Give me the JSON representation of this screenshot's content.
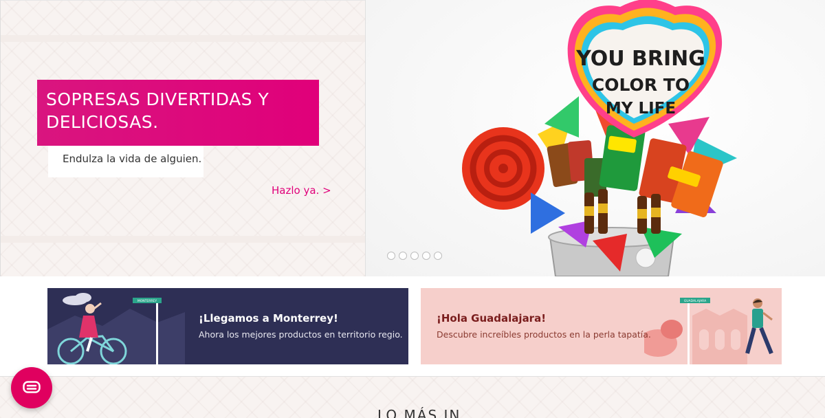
{
  "hero": {
    "title": "SOPRESAS DIVERTIDAS Y DELICIOSAS.",
    "subtitle": "Endulza la vida de alguien.",
    "cta": "Hazlo ya. >",
    "balloon_text": [
      "YOU BRING",
      "COLOR TO",
      "MY LIFE"
    ],
    "slide_count": 5,
    "active_slide": 1
  },
  "promos": {
    "monterrey": {
      "title": "¡Llegamos a Monterrey!",
      "description": "Ahora los mejores productos en territorio regio.",
      "sign_text": "MONTERREY"
    },
    "guadalajara": {
      "title": "¡Hola Guadalajara!",
      "description": "Descubre increíbles productos en la perla tapatía.",
      "sign_text": "GUADALAJARA"
    }
  },
  "section": {
    "heading": "LO MÁS IN"
  },
  "chat": {
    "icon": "chat-bubble-icon"
  },
  "colors": {
    "brand_pink": "#e0007a",
    "monterrey_bg": "#2e2f55",
    "guadalajara_bg": "#f6cfcb"
  }
}
